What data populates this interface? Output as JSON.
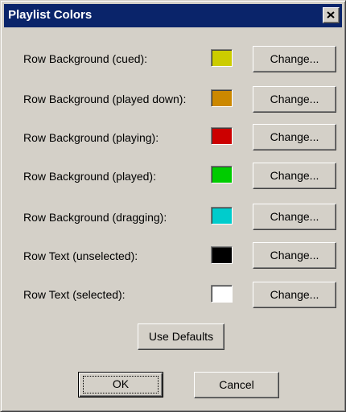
{
  "window": {
    "title": "Playlist Colors"
  },
  "rows": [
    {
      "label": "Row Background (cued):",
      "color": "#cccc00",
      "button_label": "Change..."
    },
    {
      "label": "Row Background (played down):",
      "color": "#cc8800",
      "button_label": "Change..."
    },
    {
      "label": "Row Background (playing):",
      "color": "#cc0000",
      "button_label": "Change..."
    },
    {
      "label": "Row Background (played):",
      "color": "#00cc00",
      "button_label": "Change..."
    },
    {
      "label": "Row Background (dragging):",
      "color": "#00cccc",
      "button_label": "Change..."
    },
    {
      "label": "Row Text (unselected):",
      "color": "#000000",
      "button_label": "Change..."
    },
    {
      "label": "Row Text (selected):",
      "color": "#ffffff",
      "button_label": "Change..."
    }
  ],
  "buttons": {
    "defaults_label": "Use Defaults",
    "ok_label": "OK",
    "cancel_label": "Cancel"
  },
  "icons": {
    "close": "close-icon"
  }
}
